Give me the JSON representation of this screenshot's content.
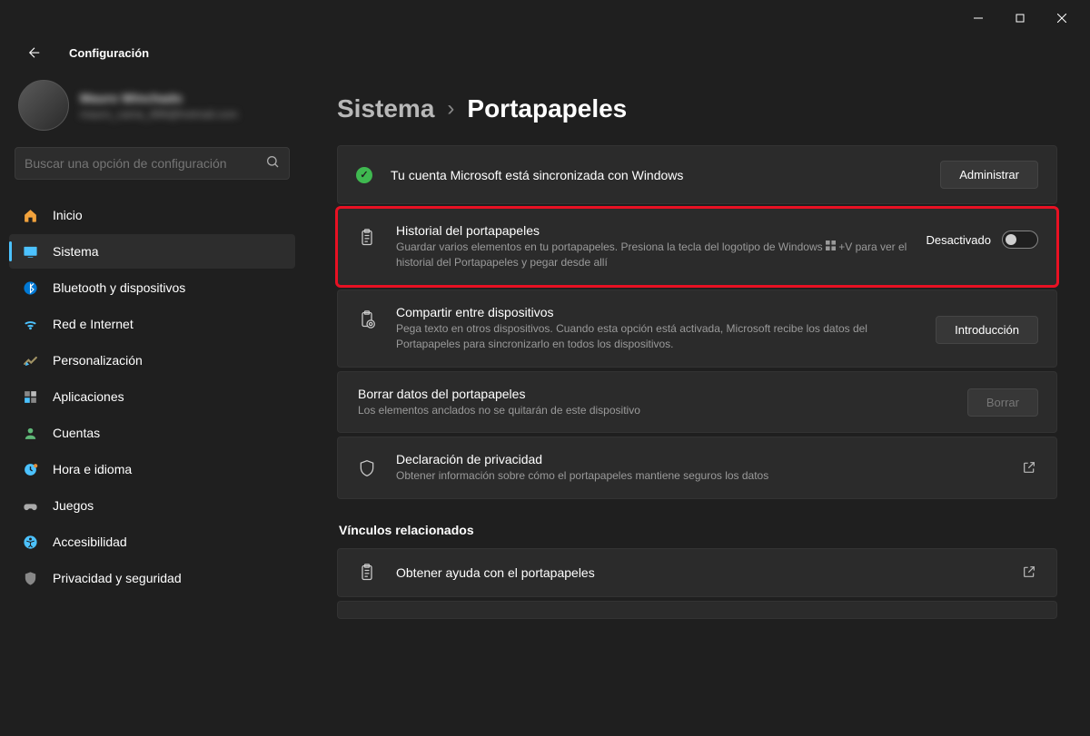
{
  "window": {
    "app_title": "Configuración"
  },
  "profile": {
    "name": "Mauro Winchado",
    "email": "mauro_cama_899@hotmail.com"
  },
  "search": {
    "placeholder": "Buscar una opción de configuración"
  },
  "nav": [
    {
      "label": "Inicio",
      "icon": "home"
    },
    {
      "label": "Sistema",
      "icon": "system",
      "active": true
    },
    {
      "label": "Bluetooth y dispositivos",
      "icon": "bluetooth"
    },
    {
      "label": "Red e Internet",
      "icon": "network"
    },
    {
      "label": "Personalización",
      "icon": "personalize"
    },
    {
      "label": "Aplicaciones",
      "icon": "apps"
    },
    {
      "label": "Cuentas",
      "icon": "accounts"
    },
    {
      "label": "Hora e idioma",
      "icon": "time"
    },
    {
      "label": "Juegos",
      "icon": "games"
    },
    {
      "label": "Accesibilidad",
      "icon": "access"
    },
    {
      "label": "Privacidad y seguridad",
      "icon": "privacy"
    }
  ],
  "breadcrumb": {
    "parent": "Sistema",
    "current": "Portapapeles"
  },
  "account_sync": {
    "text": "Tu cuenta Microsoft está sincronizada con Windows",
    "button": "Administrar"
  },
  "history": {
    "title": "Historial del portapapeles",
    "desc_before": "Guardar varios elementos en tu portapapeles. Presiona la tecla del logotipo de Windows ",
    "desc_after": " +V para ver el historial del Portapapeles y pegar desde allí",
    "state": "Desactivado"
  },
  "share": {
    "title": "Compartir entre dispositivos",
    "desc": "Pega texto en otros dispositivos. Cuando esta opción está activada, Microsoft recibe los datos del Portapapeles para sincronizarlo en todos los dispositivos.",
    "button": "Introducción"
  },
  "clear": {
    "title": "Borrar datos del portapapeles",
    "desc": "Los elementos anclados no se quitarán de este dispositivo",
    "button": "Borrar"
  },
  "privacy": {
    "title": "Declaración de privacidad",
    "desc": "Obtener información sobre cómo el portapapeles mantiene seguros los datos"
  },
  "related": {
    "heading": "Vínculos relacionados",
    "help": "Obtener ayuda con el portapapeles"
  }
}
